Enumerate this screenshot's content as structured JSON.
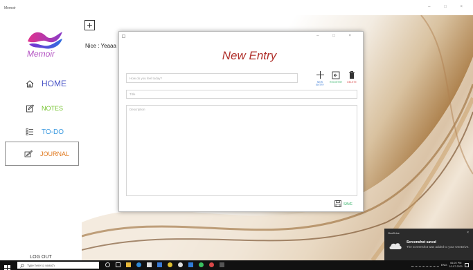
{
  "window": {
    "title": "Memoir",
    "controls": [
      "–",
      "□",
      "×"
    ]
  },
  "sidebar": {
    "logo_text": "Memoir",
    "items": [
      {
        "label": "HOME",
        "icon": "home-icon",
        "color": "#4a55c7"
      },
      {
        "label": "NOTES",
        "icon": "notes-edit-icon",
        "color": "#72c22a"
      },
      {
        "label": "TO-DO",
        "icon": "checklist-icon",
        "color": "#3d9be0"
      },
      {
        "label": "JOURNAL",
        "icon": "journal-pen-icon",
        "color": "#e07a20",
        "selected": true
      }
    ],
    "logout_label": "LOG OUT"
  },
  "main": {
    "add_icon": "plus-square-icon",
    "greeting": "Nice : Yeaaa"
  },
  "dialog": {
    "title": "New Entry",
    "feel_placeholder": "How do you feel today?",
    "title_placeholder": "Title",
    "description_placeholder": "Description",
    "tools": [
      {
        "label": "NEW ENTRY",
        "icon": "plus-icon",
        "color": "#3a7bd5"
      },
      {
        "label": "REGISTER",
        "icon": "exit-icon",
        "color": "#38b36a"
      },
      {
        "label": "DELETE",
        "icon": "trash-icon",
        "color": "#d94848"
      }
    ],
    "save_label": "SAVE",
    "title_color": "#b0302b"
  },
  "toast": {
    "app": "OneDrive",
    "title": "Screenshot saved",
    "body": "The screenshot was added to your OneDrive."
  },
  "taskbar": {
    "search_placeholder": "Type here to search",
    "language": "ENG",
    "time": "06:20 PM",
    "date": "10-07-2021"
  }
}
